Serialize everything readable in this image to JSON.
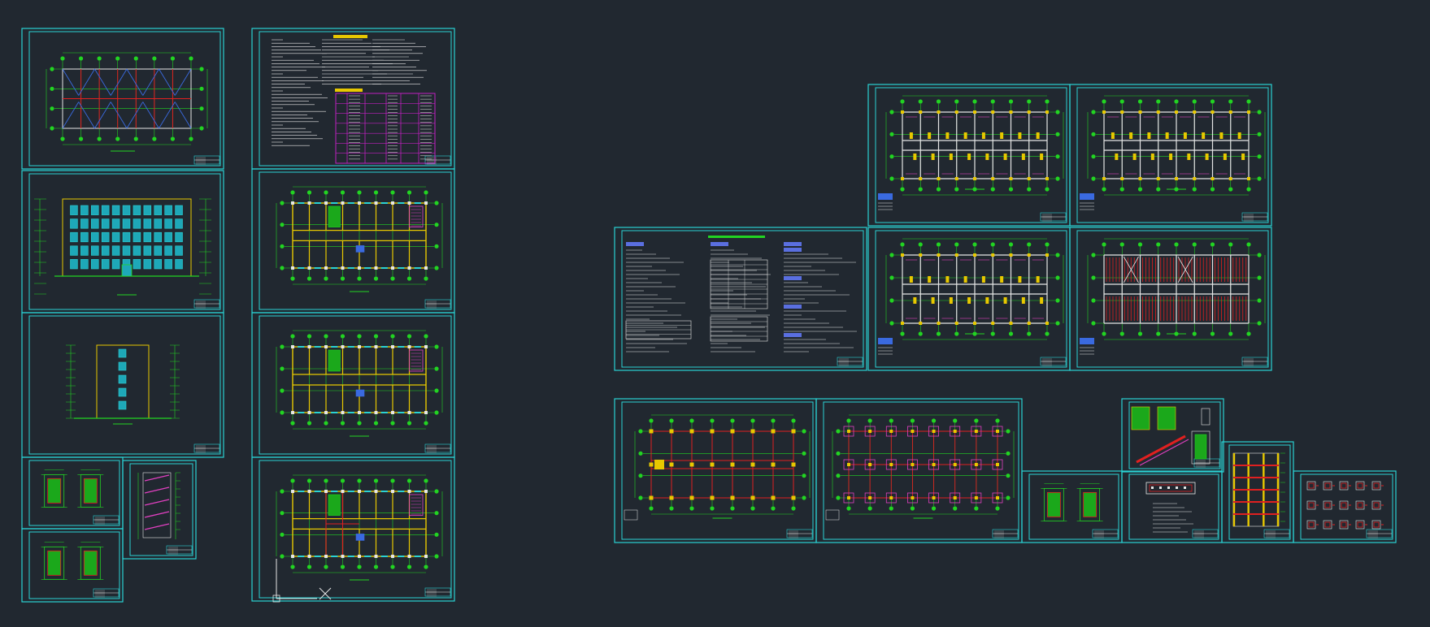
{
  "viewport": {
    "background": "#212830"
  },
  "colors": {
    "sheet_frame": "#2ad2d4",
    "grid_green": "#22d422",
    "grid_red": "#e02020",
    "wall_yellow": "#e8c800",
    "text_white": "#e6e6e6",
    "magenta": "#c020c0",
    "blue_header": "#5a6fe0",
    "cyan_fill": "#2ad2d4"
  },
  "ucs_icon": {
    "name": "ucs-icon",
    "crosshair": "cursor-crosshair-icon"
  },
  "sheets": [
    {
      "id": "arch-roof-plan",
      "kind": "roof_plan"
    },
    {
      "id": "arch-elevation-front",
      "kind": "elevation_front"
    },
    {
      "id": "arch-elevation-side",
      "kind": "elevation_side"
    },
    {
      "id": "arch-detail-a",
      "kind": "detail_small"
    },
    {
      "id": "arch-stair-section",
      "kind": "stair_section"
    },
    {
      "id": "arch-detail-b",
      "kind": "detail_small"
    },
    {
      "id": "arch-design-notes",
      "kind": "notes_table"
    },
    {
      "id": "arch-floor-plan-1",
      "kind": "floor_plan"
    },
    {
      "id": "arch-floor-plan-2",
      "kind": "floor_plan"
    },
    {
      "id": "arch-floor-plan-3",
      "kind": "floor_plan"
    },
    {
      "id": "struct-general-notes",
      "kind": "notes_struct"
    },
    {
      "id": "struct-beam-plan-1",
      "kind": "struct_plan"
    },
    {
      "id": "struct-beam-plan-2",
      "kind": "struct_plan"
    },
    {
      "id": "struct-slab-plan-1",
      "kind": "struct_plan"
    },
    {
      "id": "struct-slab-plan-2",
      "kind": "struct_plan_red"
    },
    {
      "id": "struct-column-plan",
      "kind": "column_plan"
    },
    {
      "id": "struct-foundation-plan",
      "kind": "foundation_plan"
    },
    {
      "id": "struct-stair-detail",
      "kind": "stair_detail"
    },
    {
      "id": "struct-node-detail-a",
      "kind": "detail_small"
    },
    {
      "id": "struct-node-detail-b",
      "kind": "beam_detail"
    },
    {
      "id": "struct-column-elevation",
      "kind": "column_elevation"
    },
    {
      "id": "struct-column-sections",
      "kind": "column_sections"
    }
  ]
}
